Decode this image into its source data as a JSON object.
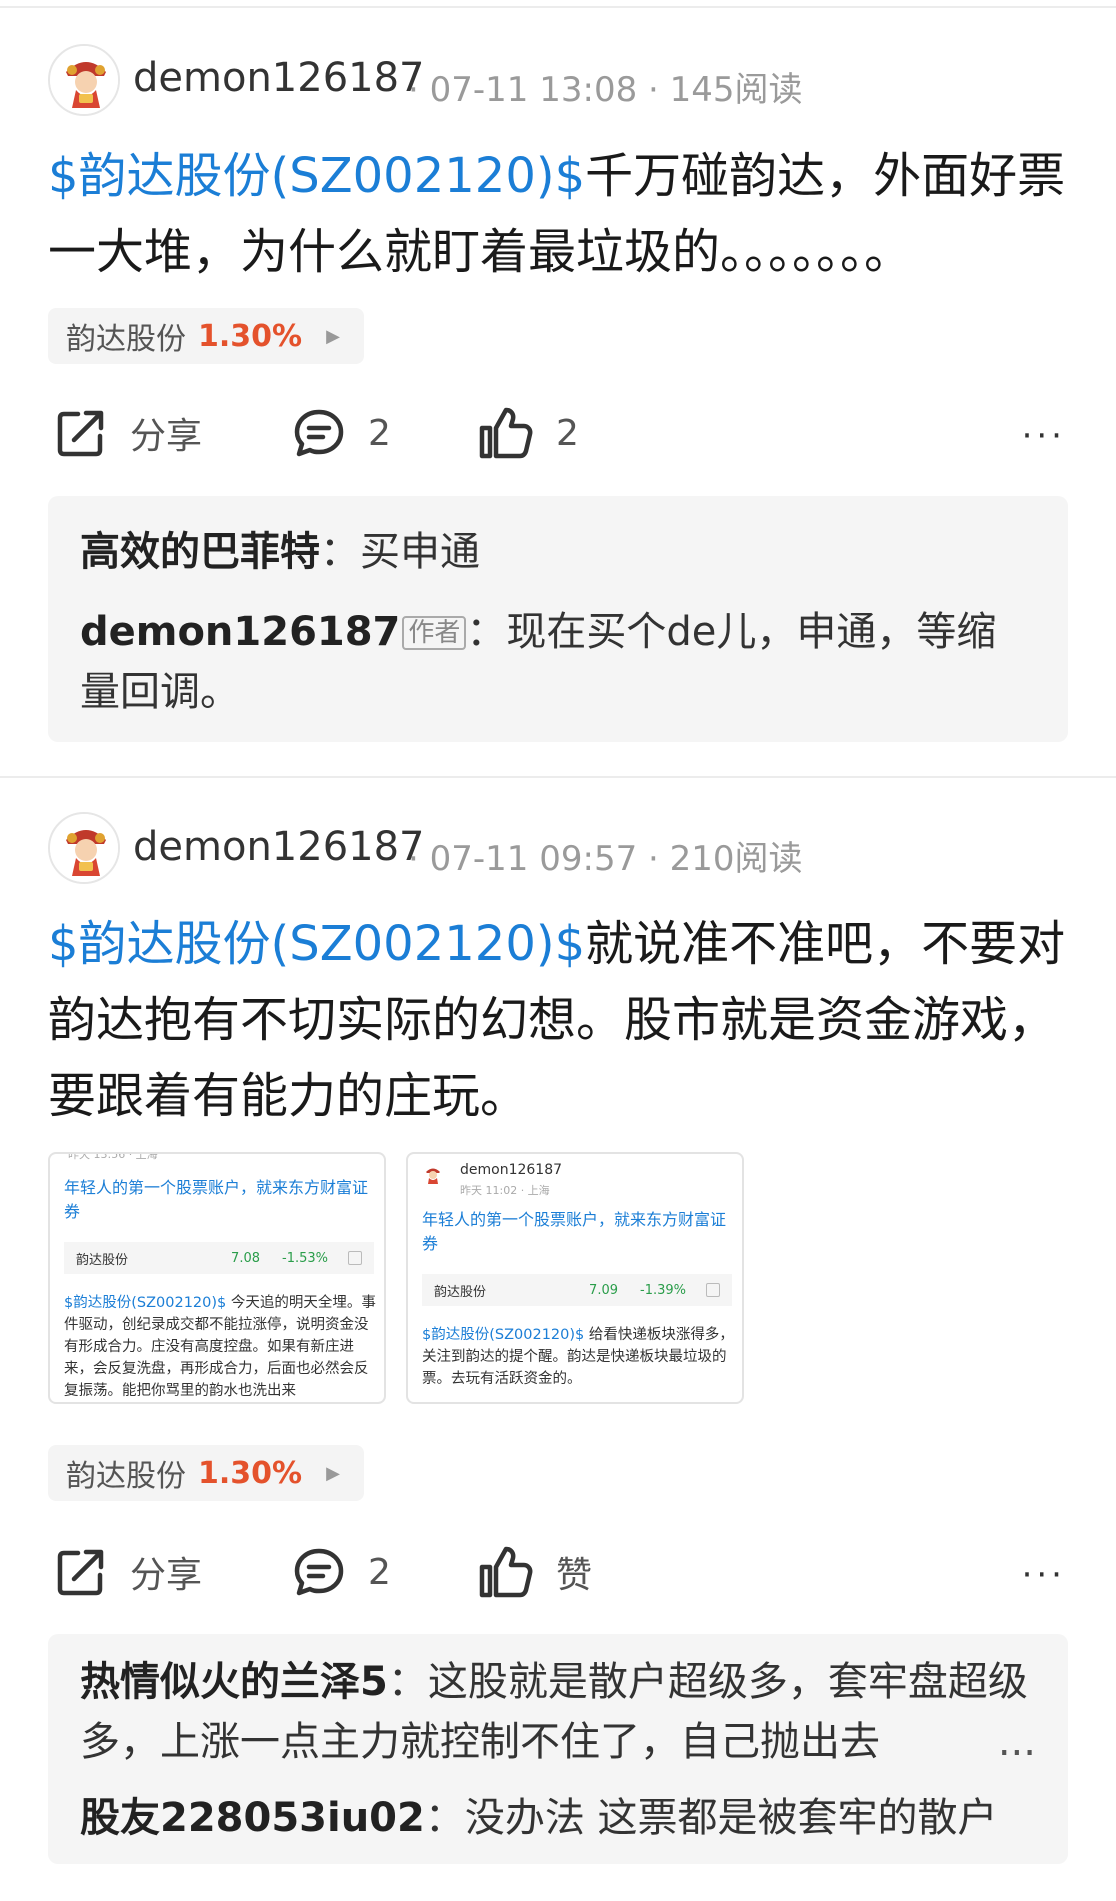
{
  "posts": [
    {
      "username": "demon126187",
      "meta": "· 07-11 13:08 · 145阅读",
      "tag": "$韵达股份(SZ002120)$",
      "text": "千万碰韵达，外面好票一大堆，为什么就盯着最垃圾的。。。。。。。",
      "stock_chip": {
        "name": "韵达股份",
        "change": "1.30%"
      },
      "actions": {
        "share": "分享",
        "comments": "2",
        "likes": "2",
        "more": "···"
      },
      "comments": [
        {
          "author": "高效的巴菲特",
          "sep": "：",
          "text": "买申通"
        },
        {
          "author": "demon126187",
          "badge": "作者",
          "sep": "：",
          "text": "现在买个de儿，申通，等缩量回调。"
        }
      ]
    },
    {
      "username": "demon126187",
      "meta": "· 07-11 09:57 · 210阅读",
      "tag": "$韵达股份(SZ002120)$",
      "text": "就说准不准吧，不要对韵达抱有不切实际的幻想。股市就是资金游戏，要跟着有能力的庄玩。",
      "images": [
        {
          "user": "",
          "time": "昨天 13:56 · 上海",
          "ad": "年轻人的第一个股票账户，就来东方财富证券",
          "row_name": "韵达股份",
          "row_price": "7.08",
          "row_change": "-1.53%",
          "tag": "$韵达股份(SZ002120)$",
          "text": "今天追的明天全埋。事件驱动，创纪录成交都不能拉涨停，说明资金没有形成合力。庄没有高度控盘。如果有新庄进来，会反复洗盘，再形成合力，后面也必然会反复振荡。能把你骂里的韵水也洗出来"
        },
        {
          "user": "demon126187",
          "time": "昨天 11:02 · 上海",
          "ad": "年轻人的第一个股票账户，就来东方财富证券",
          "row_name": "韵达股份",
          "row_price": "7.09",
          "row_change": "-1.39%",
          "tag": "$韵达股份(SZ002120)$",
          "text": "给看快递板块涨得多，关注到韵达的提个醒。韵达是快递板块最垃圾的票。去玩有活跃资金的。"
        }
      ],
      "stock_chip": {
        "name": "韵达股份",
        "change": "1.30%"
      },
      "actions": {
        "share": "分享",
        "comments": "2",
        "likes": "赞",
        "more": "···"
      },
      "comments": [
        {
          "author": "热情似火的兰泽5",
          "sep": "：",
          "text": "这股就是散户超级多，套牢盘超级多，上涨一点主力就控制不住了，自己抛出去",
          "ellipsis": "..."
        },
        {
          "author": "股友228053iu02",
          "sep": "：",
          "text": "没办法 这票都是被套牢的散户"
        }
      ]
    }
  ],
  "colors": {
    "tag": "#1b7ed6",
    "up": "#e4522c",
    "down": "#2a9d4a"
  }
}
